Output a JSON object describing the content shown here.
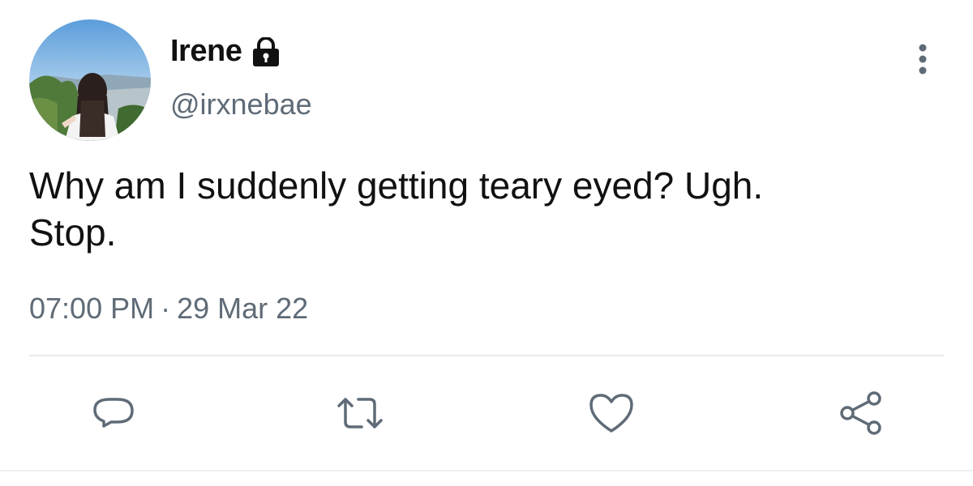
{
  "tweet": {
    "display_name": "Irene",
    "handle": "@irxnebae",
    "text_line1": "Why am I suddenly getting teary eyed? Ugh.",
    "text_line2": "Stop.",
    "time": "07:00 PM",
    "separator": "·",
    "date": "29 Mar 22"
  },
  "icons": {
    "protected": "lock-icon",
    "more": "more-vertical-icon",
    "reply": "reply-icon",
    "retweet": "retweet-icon",
    "like": "heart-icon",
    "share": "share-icon"
  },
  "colors": {
    "text": "#111111",
    "secondary": "#5f6b76",
    "divider": "#e6ebee"
  }
}
